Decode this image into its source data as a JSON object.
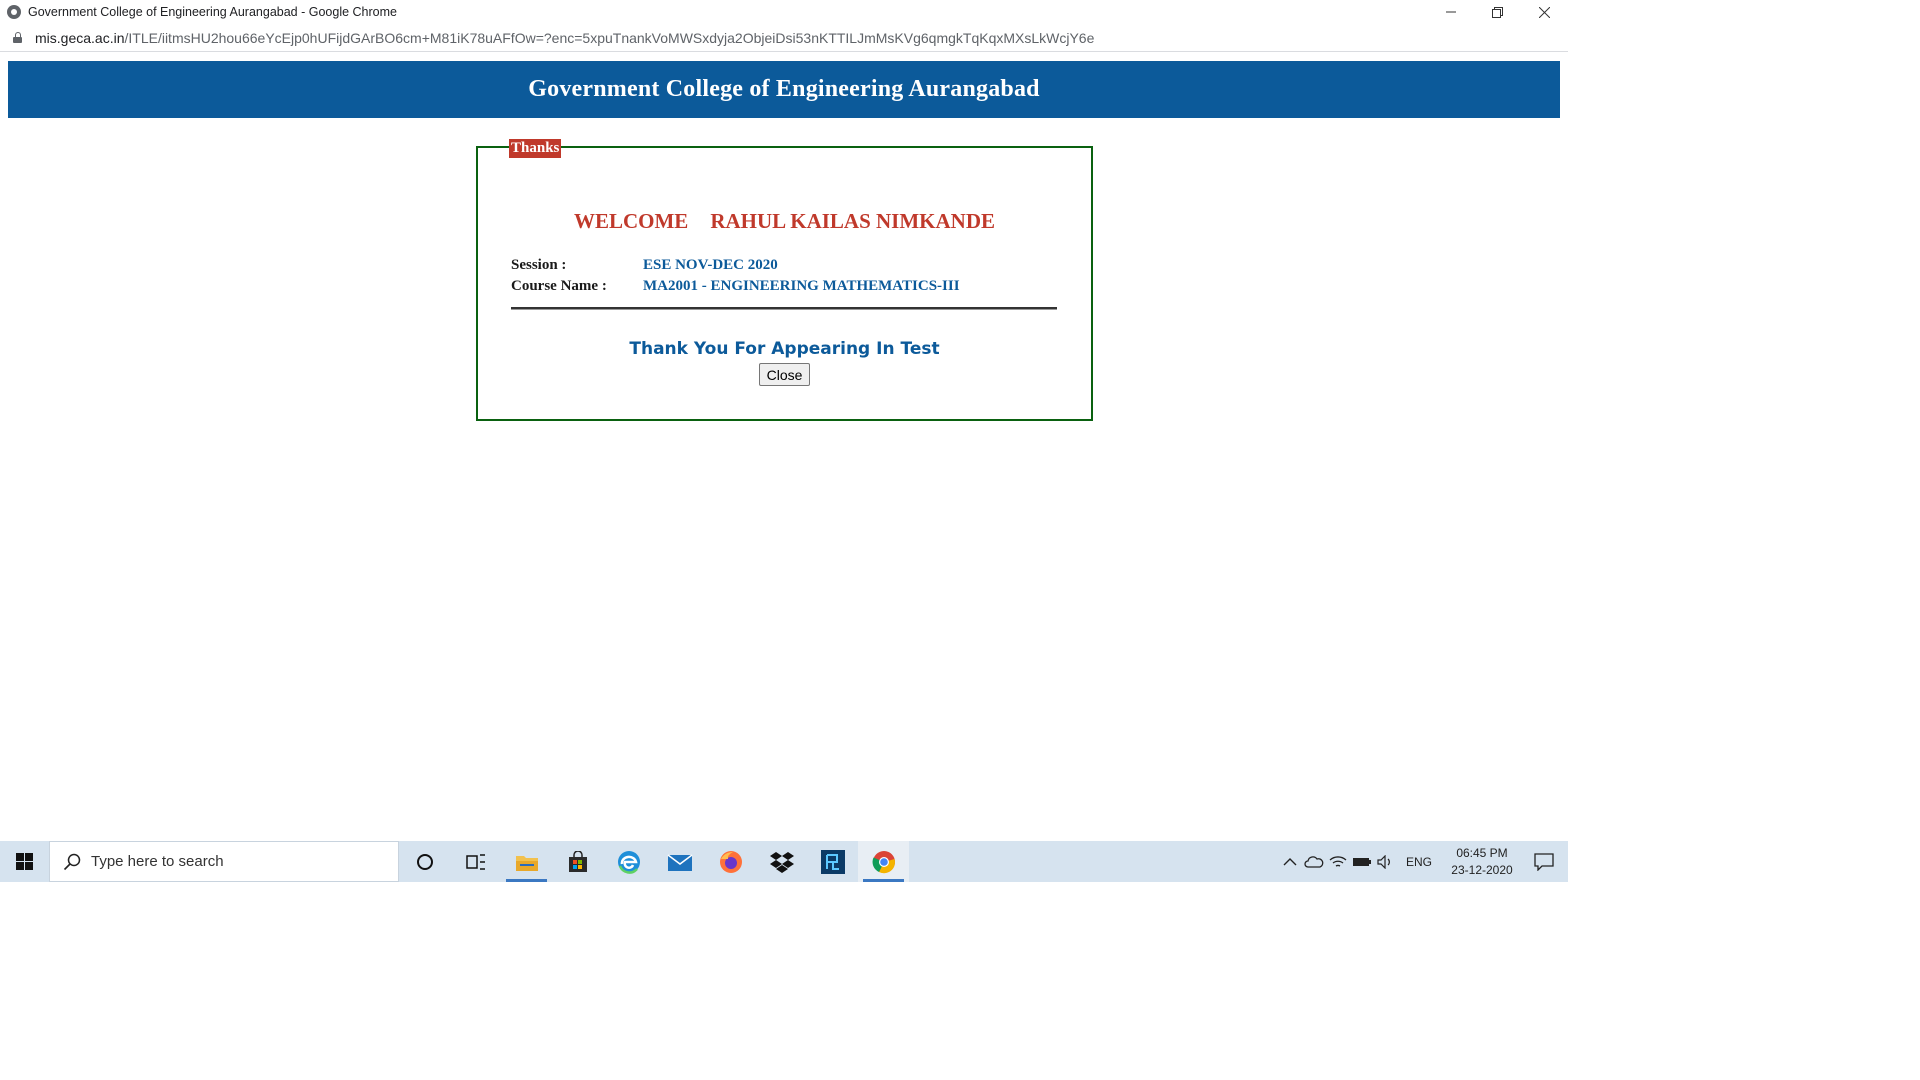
{
  "window": {
    "title": "Government College of Engineering Aurangabad - Google Chrome"
  },
  "address_bar": {
    "host": "mis.geca.ac.in",
    "path": "/ITLE/iitmsHU2hou66eYcEjp0hUFijdGArBO6cm+M81iK78uAFfOw=?enc=5xpuTnankVoMWSxdyja2ObjeiDsi53nKTTILJmMsKVg6qmgkTqKqxMXsLkWcjY6e"
  },
  "page": {
    "header_title": "Government College of Engineering Aurangabad",
    "legend": "Thanks",
    "welcome_label": "WELCOME",
    "student_name": "RAHUL KAILAS NIMKANDE",
    "session_label": "Session :",
    "session_value": "ESE NOV-DEC 2020",
    "course_label": "Course Name :",
    "course_value": "MA2001 - ENGINEERING MATHEMATICS-III",
    "thank_message": "Thank You For Appearing In Test",
    "close_label": "Close"
  },
  "taskbar": {
    "search_placeholder": "Type here to search",
    "language": "ENG",
    "time": "06:45 PM",
    "date": "23-12-2020",
    "icons": [
      "windows-start-icon",
      "cortana-icon",
      "task-view-icon",
      "file-explorer-icon",
      "store-icon",
      "edge-icon",
      "mail-icon",
      "firefox-icon",
      "dropbox-icon",
      "app-icon",
      "chrome-icon"
    ]
  },
  "colors": {
    "header_blue": "#0c5a9a",
    "welcome_red": "#c0392b",
    "fieldset_green": "#0a6110",
    "taskbar_bg": "#d6e3ef"
  }
}
